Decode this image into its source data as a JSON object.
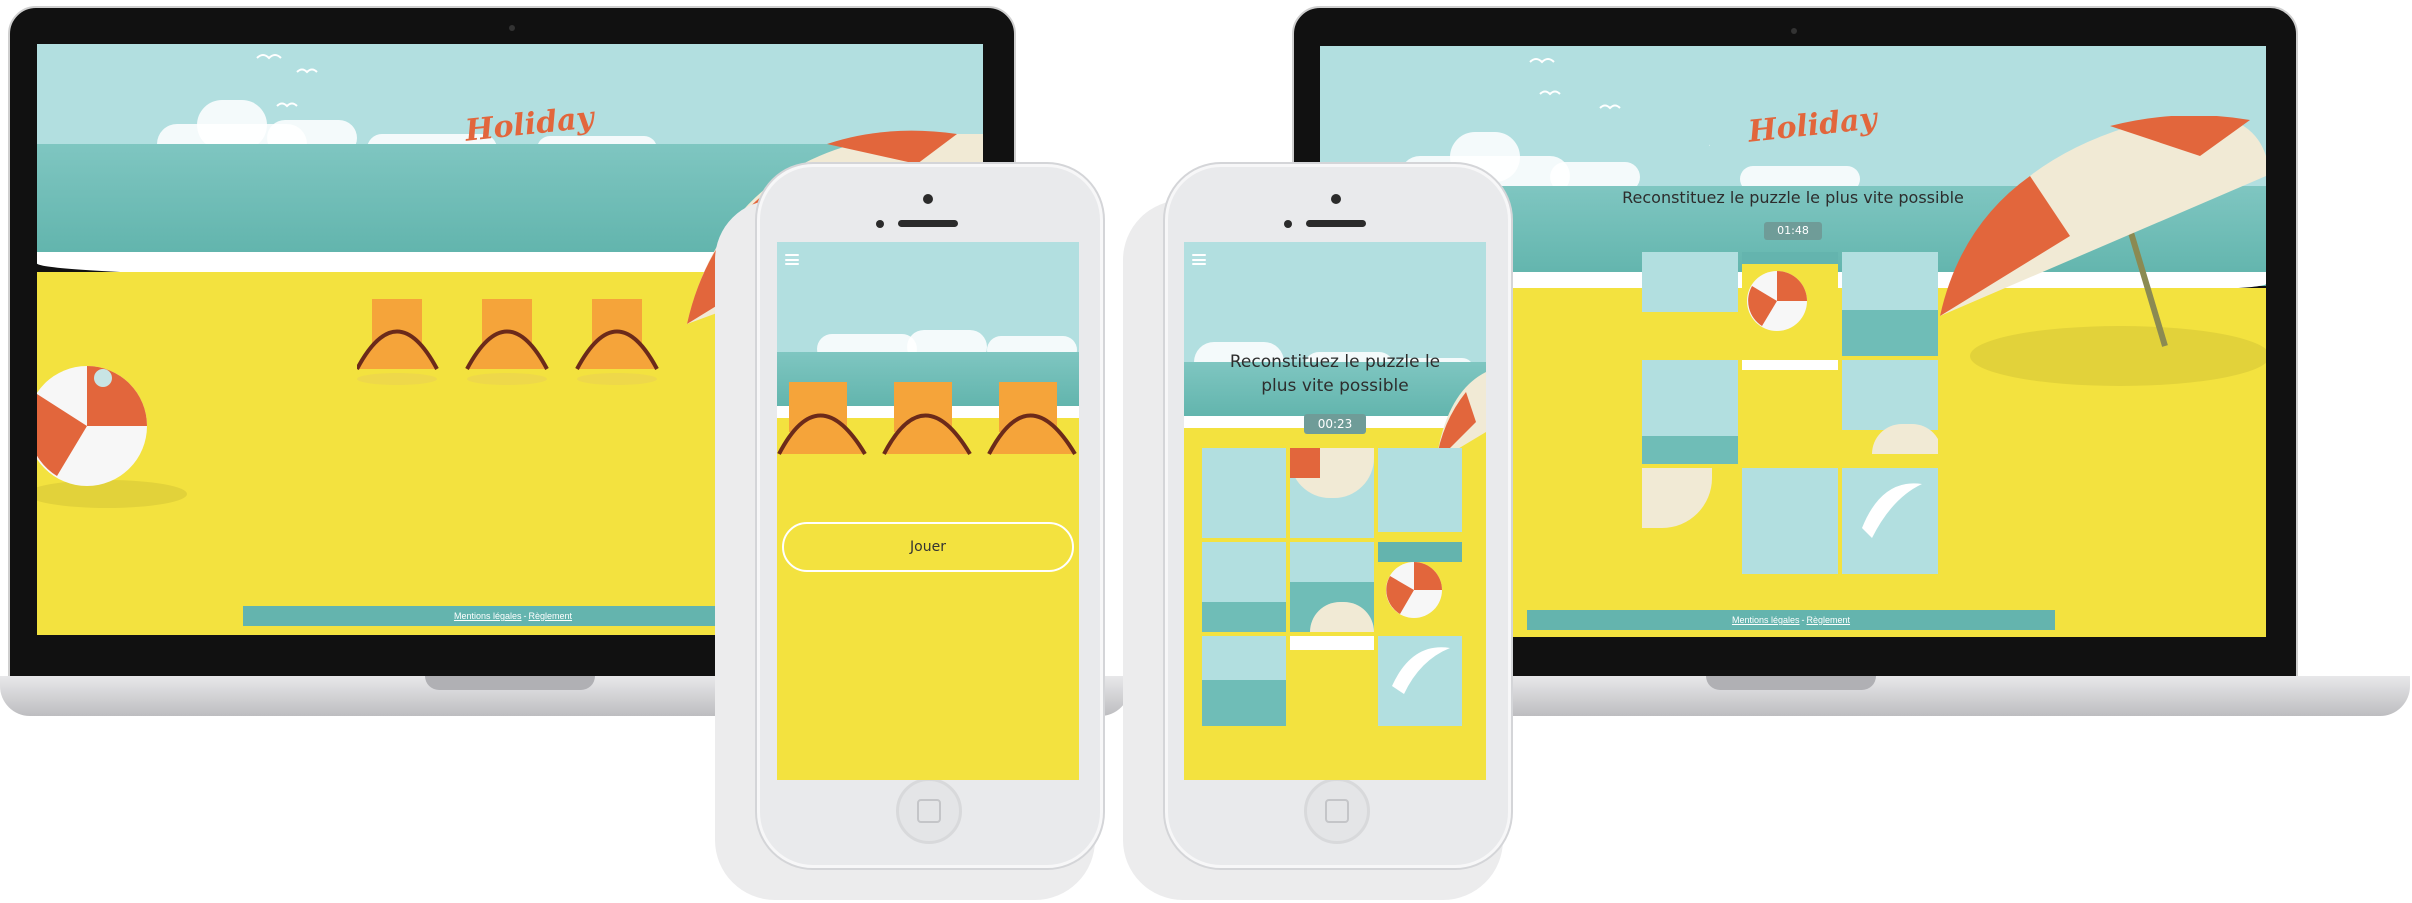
{
  "brand": {
    "logo_text": "Holiday",
    "accent": "#e2663c"
  },
  "colors": {
    "sky": "#b2dfe0",
    "sea": "#5fb3ab",
    "sand": "#f3e23f",
    "footer": "#64b4ae",
    "timer_bg": "#6f9c98"
  },
  "laptop_home": {
    "footer": {
      "legal_label": "Mentions légales",
      "separator": "-",
      "rules_label": "Règlement"
    }
  },
  "laptop_puzzle": {
    "title": "Reconstituez le puzzle le plus vite possible",
    "timer": "01:48",
    "footer": {
      "legal_label": "Mentions légales",
      "separator": "-",
      "rules_label": "Règlement"
    }
  },
  "phone_home": {
    "menu_icon": "hamburger-icon",
    "play_label": "Jouer"
  },
  "phone_puzzle": {
    "menu_icon": "hamburger-icon",
    "title_line1": "Reconstituez le puzzle le",
    "title_line2": "plus vite possible",
    "timer": "00:23"
  }
}
